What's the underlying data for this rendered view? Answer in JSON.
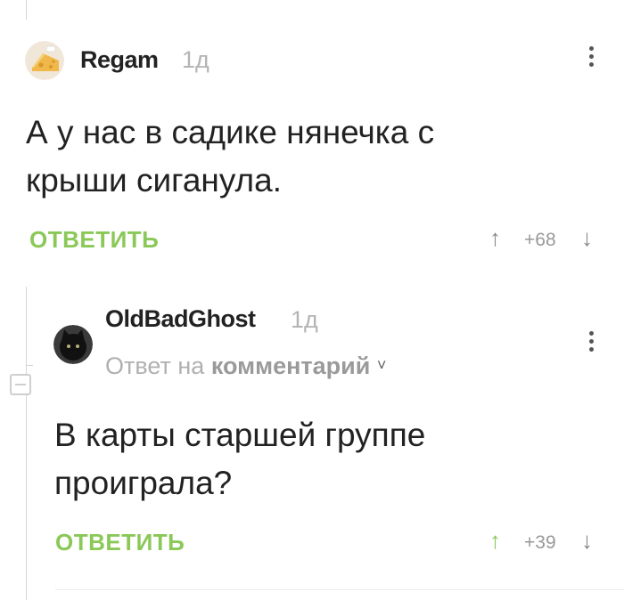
{
  "comments": [
    {
      "author": "Regam",
      "time": "1д",
      "text": "А у нас в садике нянечка с крыши сиганула.",
      "text_lines": [
        "А у нас в садике нянечка с",
        "крыши сиганула."
      ],
      "reply_label": "ОТВЕТИТЬ",
      "rating": "+68",
      "up_arrow": "↑",
      "down_arrow": "↓",
      "up_color": "#888888"
    },
    {
      "author": "OldBadGhost",
      "time": "1д",
      "reply_to_prefix": "Ответ на",
      "reply_to_link": "комментарий",
      "reply_to_chevron": "˅",
      "text": "В карты старшей группе проиграла?",
      "text_lines": [
        "В карты старшей группе",
        "проиграла?"
      ],
      "reply_label": "ОТВЕТИТЬ",
      "rating": "+39",
      "up_arrow": "↑",
      "down_arrow": "↓",
      "up_color": "#8ac858"
    }
  ],
  "colors": {
    "accent": "#8ac858",
    "muted": "#b0b0b0",
    "text": "#222222"
  },
  "icons": [
    "avatar-cheese-icon",
    "avatar-black-cat-icon",
    "more-vertical-icon",
    "collapse-thread-icon",
    "arrow-up-icon",
    "arrow-down-icon",
    "chevron-down-icon"
  ]
}
